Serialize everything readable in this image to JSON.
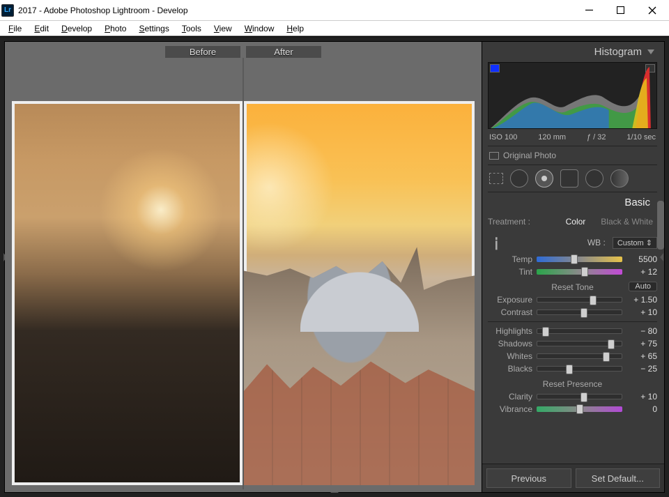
{
  "window": {
    "title": "2017 - Adobe Photoshop Lightroom - Develop",
    "app_icon_text": "Lr"
  },
  "menu": [
    "File",
    "Edit",
    "Develop",
    "Photo",
    "Settings",
    "Tools",
    "View",
    "Window",
    "Help"
  ],
  "compare": {
    "before": "Before",
    "after": "After"
  },
  "panels": {
    "histogram_title": "Histogram",
    "basic_title": "Basic",
    "meta": {
      "iso": "ISO 100",
      "focal": "120 mm",
      "fstop": "ƒ / 32",
      "shutter": "1/10 sec"
    },
    "original_photo": "Original Photo",
    "treatment_label": "Treatment :",
    "treatment_color": "Color",
    "treatment_bw": "Black & White",
    "wb_label": "WB :",
    "wb_value": "Custom",
    "reset_tone": "Reset Tone",
    "auto": "Auto",
    "reset_presence": "Reset Presence"
  },
  "sliders": {
    "temp": {
      "label": "Temp",
      "value": "5500",
      "pos": 44
    },
    "tint": {
      "label": "Tint",
      "value": "+ 12",
      "pos": 56
    },
    "exposure": {
      "label": "Exposure",
      "value": "+ 1.50",
      "pos": 66
    },
    "contrast": {
      "label": "Contrast",
      "value": "+ 10",
      "pos": 55
    },
    "highlights": {
      "label": "Highlights",
      "value": "− 80",
      "pos": 10
    },
    "shadows": {
      "label": "Shadows",
      "value": "+ 75",
      "pos": 88
    },
    "whites": {
      "label": "Whites",
      "value": "+ 65",
      "pos": 82
    },
    "blacks": {
      "label": "Blacks",
      "value": "− 25",
      "pos": 38
    },
    "clarity": {
      "label": "Clarity",
      "value": "+ 10",
      "pos": 55
    },
    "vibrance": {
      "label": "Vibrance",
      "value": "0",
      "pos": 50
    }
  },
  "buttons": {
    "previous": "Previous",
    "set_default": "Set Default..."
  }
}
